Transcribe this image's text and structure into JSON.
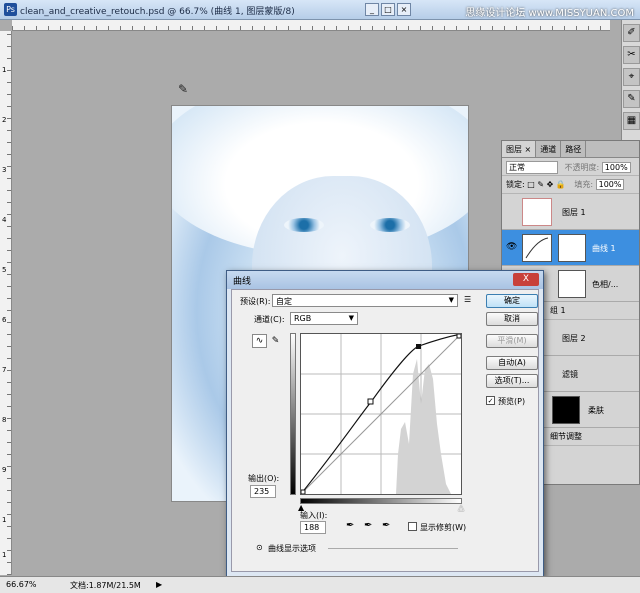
{
  "window": {
    "title": "clean_and_creative_retouch.psd @ 66.7% (曲线 1, 图层蒙版/8)",
    "site_watermark": "思缘设计论坛 www.MISSYUAN.COM",
    "min": "_",
    "max": "□",
    "close": "×"
  },
  "rulers": {
    "left_nums": [
      "1",
      "2",
      "3",
      "4",
      "5",
      "6",
      "7",
      "8",
      "9",
      "1",
      "1"
    ]
  },
  "tools": [
    "✐",
    "✂",
    "⌖",
    "✎",
    "▦",
    "▤"
  ],
  "statusbar": {
    "zoom": "66.67%",
    "doc": "文档:1.87M/21.5M",
    "arrow": "▶"
  },
  "layers_panel": {
    "tabs": [
      "图层 ×",
      "通道",
      "路径"
    ],
    "blend_mode": "正常",
    "opacity_label": "不透明度:",
    "opacity": "100%",
    "lock_label": "锁定:",
    "fill_label": "填充:",
    "fill": "100%",
    "layers": [
      {
        "name": "图层 1"
      },
      {
        "name": "曲线 1"
      },
      {
        "name": "色相/..."
      },
      {
        "name": "组 1"
      },
      {
        "name": "图层 2"
      },
      {
        "name": "滤镜"
      },
      {
        "name": "柔肤"
      },
      {
        "name": "细节调整"
      }
    ]
  },
  "curves_dialog": {
    "title": "曲线",
    "close": "X",
    "preset_label": "预设(R):",
    "preset_value": "自定",
    "channel_label": "通道(C):",
    "channel_value": "RGB",
    "output_label": "输出(O):",
    "output_value": "235",
    "input_label": "输入(I):",
    "input_value": "188",
    "show_clipping": "显示修剪(W)",
    "curve_options": "曲线显示选项",
    "buttons": {
      "ok": "确定",
      "cancel": "取消",
      "smooth": "平滑(M)",
      "auto": "自动(A)",
      "options": "选项(T)...",
      "preview": "预览(P)"
    }
  }
}
